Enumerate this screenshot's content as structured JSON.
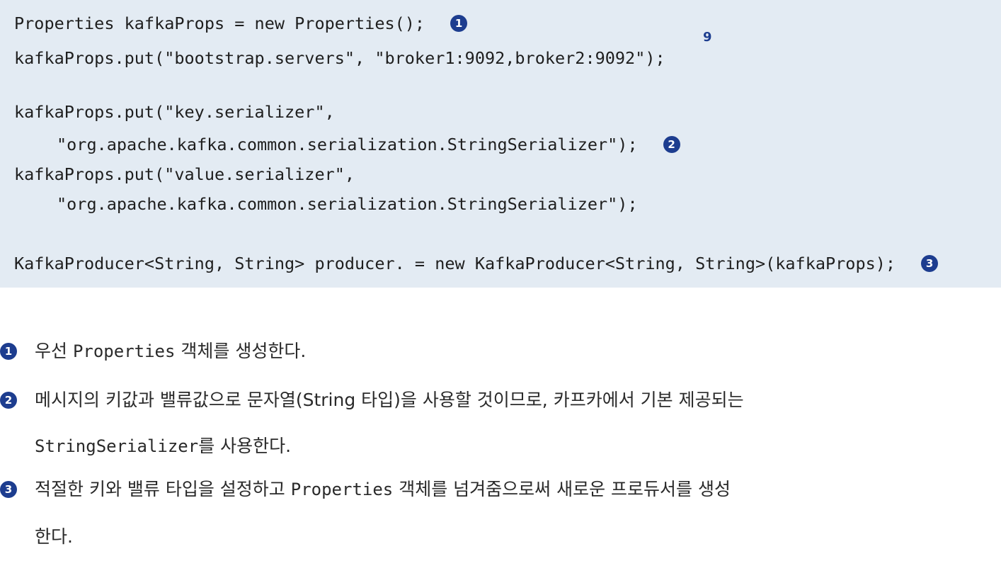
{
  "code": {
    "line1": "Properties kafkaProps = new Properties();",
    "line2": "kafkaProps.put(\"bootstrap.servers\", \"broker1:9092,broker2:9092\");",
    "line3": "kafkaProps.put(\"key.serializer\",",
    "line4": "\"org.apache.kafka.common.serialization.StringSerializer\");",
    "line5": "kafkaProps.put(\"value.serializer\",",
    "line6": "\"org.apache.kafka.common.serialization.StringSerializer\");",
    "line7": "KafkaProducer<String, String> producer. = new KafkaProducer<String, String>(kafkaProps);",
    "superscript": "9"
  },
  "markers": {
    "m1": "1",
    "m2": "2",
    "m3": "3"
  },
  "notes": {
    "n1_pre": "우선 ",
    "n1_code": "Properties",
    "n1_post": " 객체를 생성한다.",
    "n2_line1": "메시지의 키값과 밸류값으로 문자열(String 타입)을 사용할 것이므로, 카프카에서 기본 제공되는",
    "n2_code": "StringSerializer",
    "n2_post": "를 사용한다.",
    "n3_pre": "적절한 키와 밸류 타입을 설정하고 ",
    "n3_code": "Properties",
    "n3_post": " 객체를 넘겨줌으로써 새로운 프로듀서를 생성",
    "n3_line2": "한다."
  },
  "colors": {
    "code_background": "#e3ebf3",
    "marker": "#1d3d8f"
  }
}
